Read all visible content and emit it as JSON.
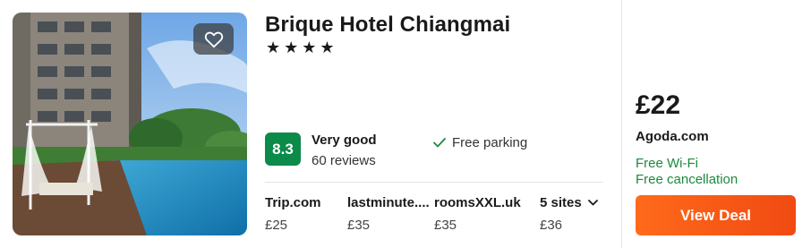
{
  "hotel": {
    "name": "Brique Hotel Chiangmai",
    "stars": "★★★★",
    "rating": {
      "score": "8.3",
      "label": "Very good",
      "reviews": "60 reviews"
    },
    "amenity": "Free parking",
    "favorite_icon": "heart-icon",
    "photo_icon": "hotel-photo"
  },
  "sites": [
    {
      "name": "Trip.com",
      "price": "£25"
    },
    {
      "name": "lastminute....",
      "price": "£35"
    },
    {
      "name": "roomsXXL.uk",
      "price": "£35"
    },
    {
      "name": "5 sites",
      "price": "£36"
    }
  ],
  "deal": {
    "price": "£22",
    "site": "Agoda.com",
    "perks": [
      "Free Wi-Fi",
      "Free cancellation"
    ],
    "button_label": "View Deal",
    "button_color": "#f25a15",
    "rating_color": "#0b8a4a",
    "perk_color": "#1b8a3d"
  }
}
